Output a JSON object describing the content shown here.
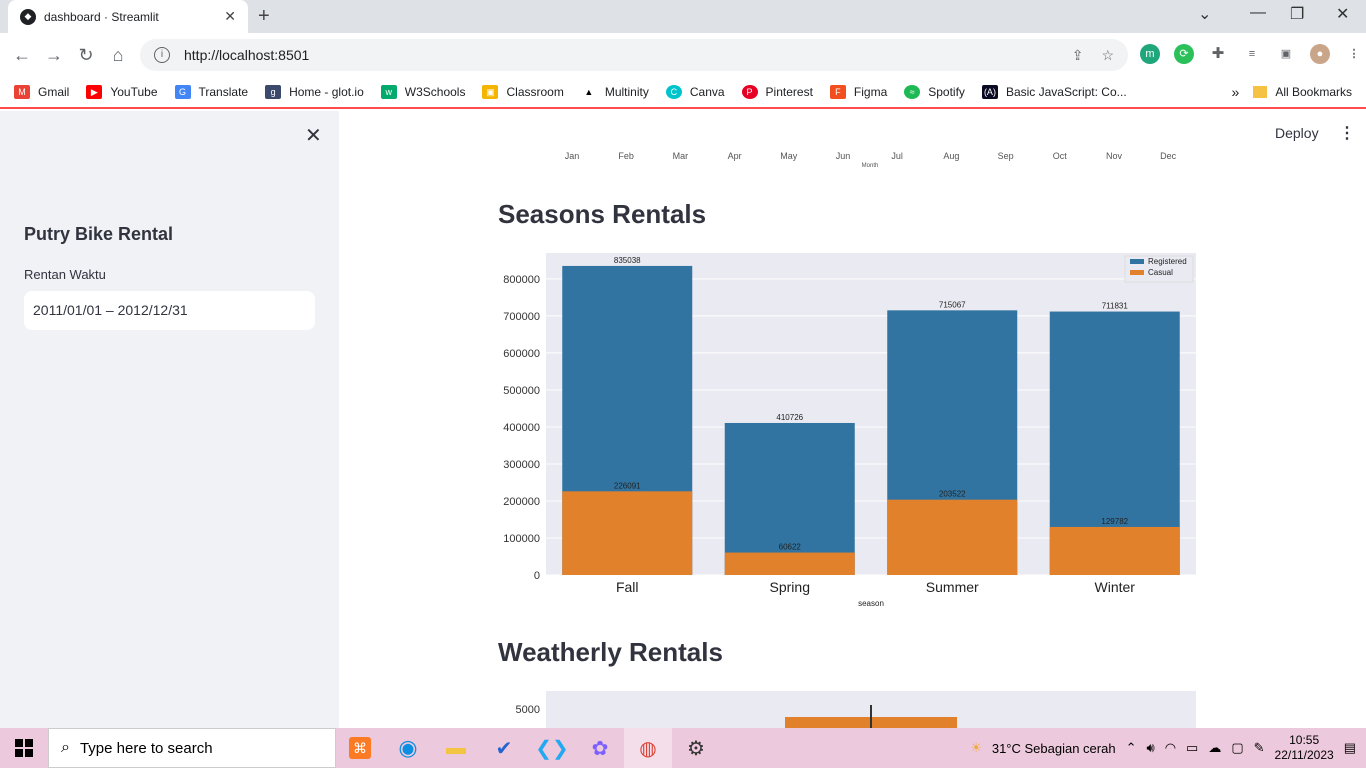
{
  "browser": {
    "tab_title": "dashboard · Streamlit",
    "url": "http://localhost:8501",
    "bookmarks": [
      "Gmail",
      "YouTube",
      "Translate",
      "Home - glot.io",
      "W3Schools",
      "Classroom",
      "Multinity",
      "Canva",
      "Pinterest",
      "Figma",
      "Spotify",
      "Basic JavaScript: Co..."
    ],
    "all_bookmarks": "All Bookmarks"
  },
  "sidebar": {
    "title": "Putry Bike Rental",
    "date_label": "Rentan Waktu",
    "date_value": "2011/01/01 – 2012/12/31"
  },
  "header": {
    "deploy": "Deploy"
  },
  "month_axis": {
    "ticks": [
      "Jan",
      "Feb",
      "Mar",
      "Apr",
      "May",
      "Jun",
      "Jul",
      "Aug",
      "Sep",
      "Oct",
      "Nov",
      "Dec"
    ],
    "label": "Month"
  },
  "sections": {
    "seasons_title": "Seasons Rentals",
    "weather_title": "Weatherly Rentals"
  },
  "chart_data": [
    {
      "type": "bar",
      "stacked": true,
      "categories": [
        "Fall",
        "Spring",
        "Summer",
        "Winter"
      ],
      "series": [
        {
          "name": "Registered",
          "values": [
            835038,
            410726,
            715067,
            711831
          ],
          "color": "#3274a1"
        },
        {
          "name": "Casual",
          "values": [
            226091,
            60622,
            203522,
            129782
          ],
          "color": "#e1812c"
        }
      ],
      "xlabel": "season",
      "ylabel": "",
      "ylim": [
        0,
        870000
      ],
      "yticks": [
        0,
        100000,
        200000,
        300000,
        400000,
        500000,
        600000,
        700000,
        800000
      ],
      "legend_position": "top-right"
    },
    {
      "type": "bar",
      "partial": true,
      "yticks": [
        5000
      ],
      "color": "#e1812c"
    }
  ],
  "taskbar": {
    "search_placeholder": "Type here to search",
    "weather": "31°C  Sebagian cerah",
    "time": "10:55",
    "date": "22/11/2023"
  }
}
